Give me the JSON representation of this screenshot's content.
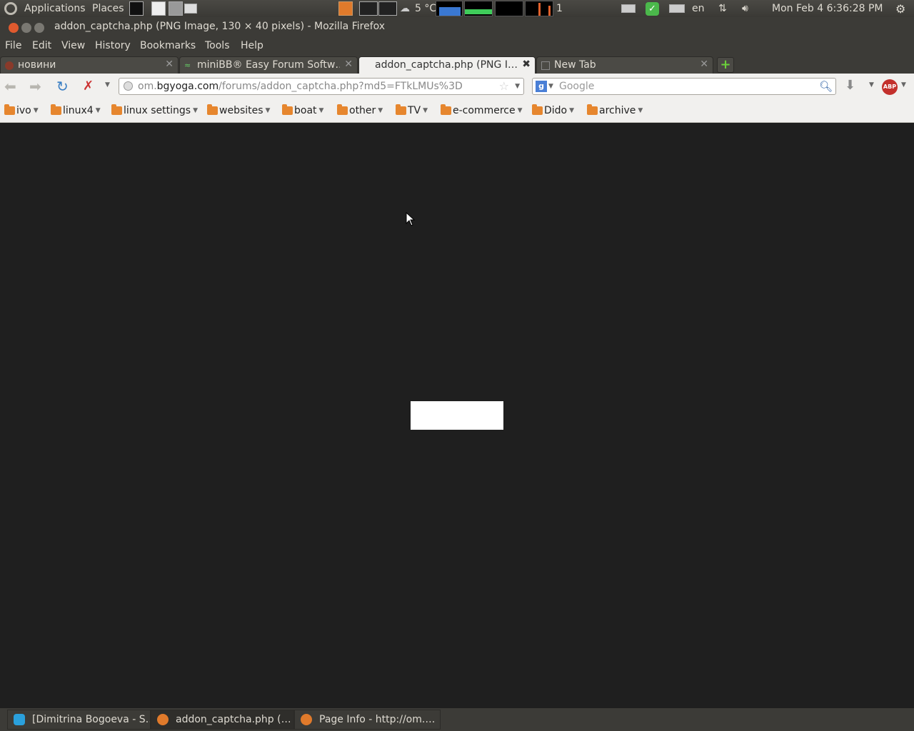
{
  "top_panel": {
    "applications": "Applications",
    "places": "Places",
    "weather": "5 °C",
    "workspace_number": "1",
    "keyboard_layout": "en",
    "clock": "Mon Feb  4  6:36:28 PM"
  },
  "window": {
    "title": "addon_captcha.php (PNG Image, 130 × 40 pixels) - Mozilla Firefox"
  },
  "menu": {
    "file": "File",
    "edit": "Edit",
    "view": "View",
    "history": "History",
    "bookmarks": "Bookmarks",
    "tools": "Tools",
    "help": "Help"
  },
  "tabs": [
    {
      "label": "новини"
    },
    {
      "label": "miniBB® Easy Forum Softw…"
    },
    {
      "label": "addon_captcha.php (PNG I…"
    },
    {
      "label": "New Tab"
    }
  ],
  "navbar": {
    "url_prefix": "om.",
    "url_domain": "bgyoga.com",
    "url_path": "/forums/addon_captcha.php?md5=FTkLMUs%3D",
    "search_placeholder": "Google"
  },
  "bookmarks_toolbar": [
    {
      "label": "ivo"
    },
    {
      "label": "linux4"
    },
    {
      "label": "linux settings"
    },
    {
      "label": "websites"
    },
    {
      "label": "boat"
    },
    {
      "label": "other"
    },
    {
      "label": "TV"
    },
    {
      "label": "e-commerce"
    },
    {
      "label": "Dido"
    },
    {
      "label": "archive"
    }
  ],
  "taskbar": [
    {
      "label": "[Dimitrina Bogoeva - S…"
    },
    {
      "label": "addon_captcha.php (…"
    },
    {
      "label": "Page Info - http://om.…"
    }
  ],
  "colors": {
    "content_bg": "#1f1f1f",
    "panel_bg": "#3c3b37",
    "captcha_fill": "#ffffff"
  }
}
